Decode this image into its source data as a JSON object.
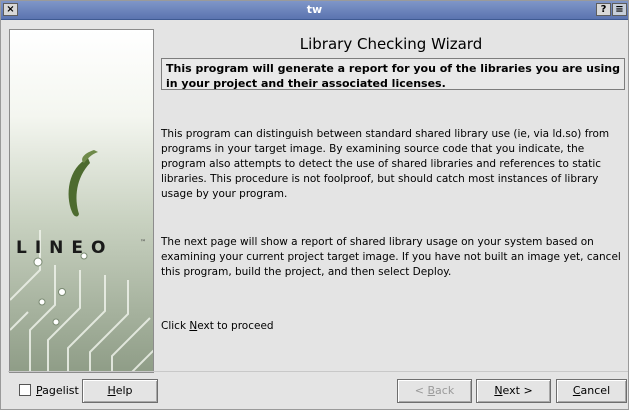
{
  "window": {
    "title": "tw",
    "close_glyph": "×",
    "help_glyph": "?",
    "menu_glyph": "≡"
  },
  "side_panel": {
    "logo_text": "LINEO",
    "logo_mark": "™",
    "logo_icon": "lineo-swoosh-icon"
  },
  "wizard": {
    "heading": "Library Checking Wizard",
    "intro": "This program will generate a report for you of the libraries you are using in your project and their associated licenses.",
    "paragraph1": "This program can distinguish between standard shared library use (ie, via ld.so) from programs in your target image. By examining source code that you indicate, the program also attempts to detect the use of shared libraries and references to static libraries. This procedure is not foolproof, but should catch most instances of library usage by your program.",
    "paragraph2": "The next page will show a report of shared library usage on your system based on examining your current project target image. If you have not built an image yet, cancel this program, build the project, and then select Deploy.",
    "paragraph3_prefix": "Click ",
    "paragraph3_mnemonic": "N",
    "paragraph3_rest": "ext to proceed"
  },
  "footer": {
    "pagelist": {
      "mnemonic": "P",
      "rest": "agelist",
      "checked": false
    },
    "help": {
      "mnemonic": "H",
      "rest": "elp"
    },
    "back": {
      "prefix": "< ",
      "mnemonic": "B",
      "rest": "ack",
      "enabled": false
    },
    "next": {
      "mnemonic": "N",
      "rest": "ext >"
    },
    "cancel": {
      "mnemonic": "C",
      "rest": "ancel"
    }
  }
}
